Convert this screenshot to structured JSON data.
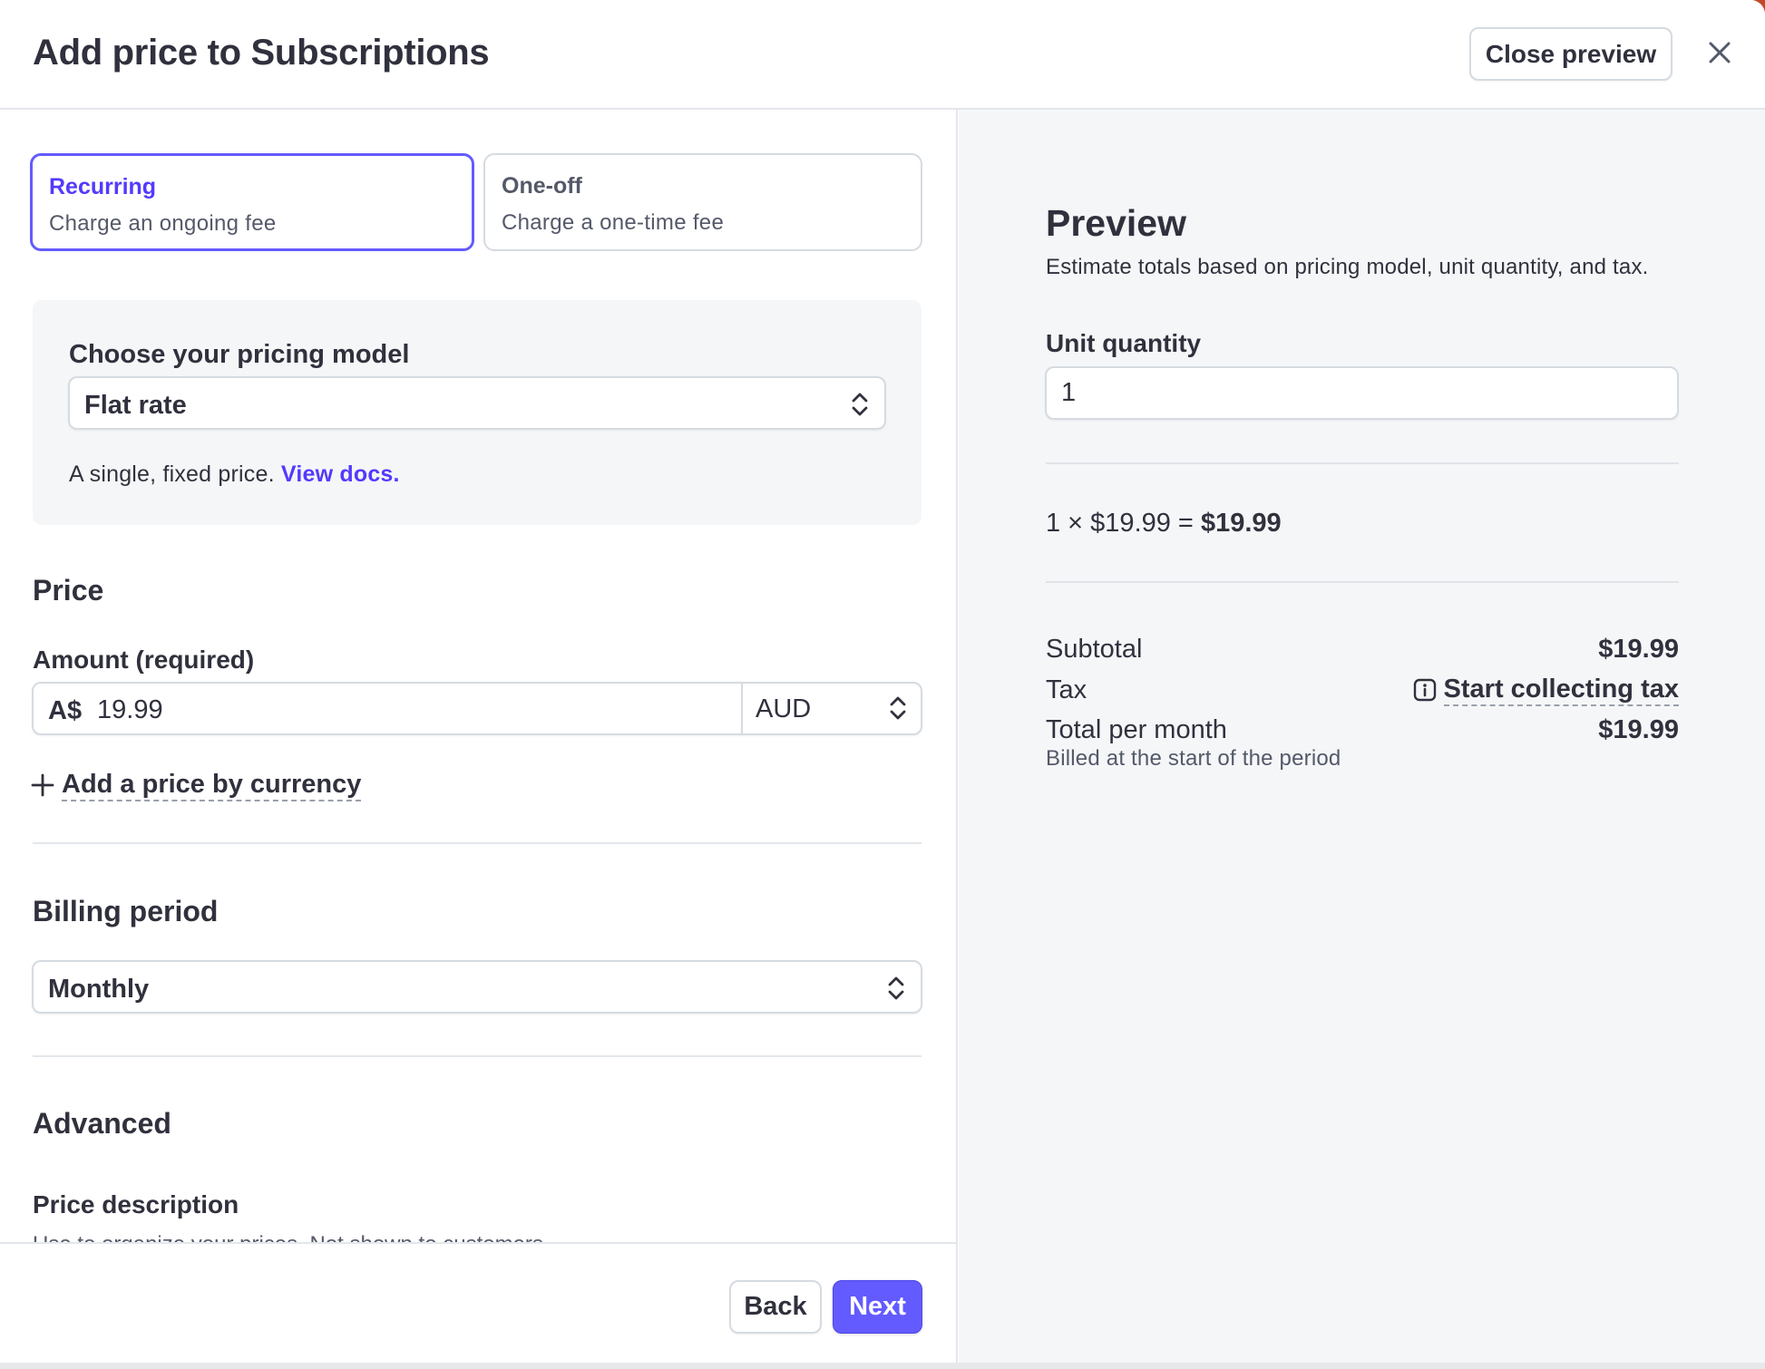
{
  "header": {
    "title": "Add price to Subscriptions",
    "close_preview_label": "Close preview"
  },
  "price_type": {
    "options": [
      {
        "title": "Recurring",
        "description": "Charge an ongoing fee",
        "selected": true
      },
      {
        "title": "One-off",
        "description": "Charge a one-time fee",
        "selected": false
      }
    ]
  },
  "pricing_model": {
    "label": "Choose your pricing model",
    "selected": "Flat rate",
    "hint": "A single, fixed price.",
    "docs_link": "View docs."
  },
  "price": {
    "section_title": "Price",
    "amount_label": "Amount (required)",
    "currency_prefix": "A$",
    "amount_value": "19.99",
    "currency": "AUD",
    "add_currency_label": "Add a price by currency"
  },
  "billing": {
    "section_title": "Billing period",
    "selected": "Monthly"
  },
  "advanced": {
    "section_title": "Advanced",
    "price_description_label": "Price description",
    "price_description_hint": "Use to organize your prices. Not shown to customers."
  },
  "footer": {
    "back_label": "Back",
    "next_label": "Next"
  },
  "preview": {
    "title": "Preview",
    "subtitle": "Estimate totals based on pricing model, unit quantity, and tax.",
    "unit_quantity_label": "Unit quantity",
    "unit_quantity_value": "1",
    "calc_text": "1 × $19.99 = ",
    "calc_total": "$19.99",
    "subtotal_label": "Subtotal",
    "subtotal_value": "$19.99",
    "tax_label": "Tax",
    "tax_link": "Start collecting tax",
    "total_label": "Total per month",
    "total_value": "$19.99",
    "billed_note": "Billed at the start of the period"
  },
  "colors": {
    "accent": "#635bff",
    "accent_text": "#533afd",
    "text": "#30313d",
    "muted": "#545969",
    "preview_bg": "#f5f6f8"
  },
  "icons": [
    "close-icon",
    "chevron-updown-icon",
    "plus-icon",
    "info-icon"
  ]
}
